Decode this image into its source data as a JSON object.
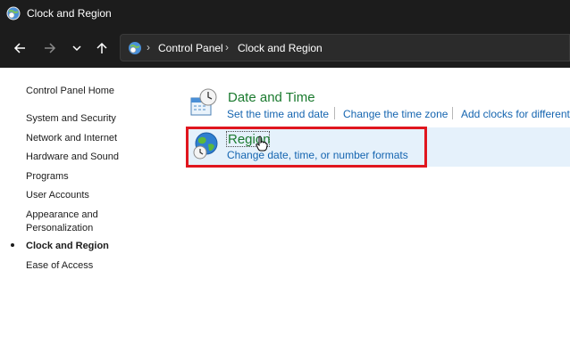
{
  "window": {
    "title": "Clock and Region"
  },
  "breadcrumb": [
    "Control Panel",
    "Clock and Region"
  ],
  "sidebar": {
    "home": "Control Panel Home",
    "items": [
      {
        "label": "System and Security",
        "active": false
      },
      {
        "label": "Network and Internet",
        "active": false
      },
      {
        "label": "Hardware and Sound",
        "active": false
      },
      {
        "label": "Programs",
        "active": false
      },
      {
        "label": "User Accounts",
        "active": false
      },
      {
        "label": "Appearance and Personalization",
        "line1": "Appearance and",
        "line2": "Personalization",
        "active": false
      },
      {
        "label": "Clock and Region",
        "active": true
      },
      {
        "label": "Ease of Access",
        "active": false
      }
    ]
  },
  "categories": [
    {
      "title": "Date and Time",
      "icon": "date-time-icon",
      "tasks": [
        "Set the time and date",
        "Change the time zone",
        "Add clocks for different"
      ]
    },
    {
      "title": "Region",
      "icon": "region-globe-icon",
      "tasks": [
        "Change date, time, or number formats"
      ]
    }
  ],
  "colors": {
    "titlebar": "#1c1c1c",
    "category_title": "#1a7a2e",
    "link": "#1565b0",
    "highlight": "#e5f1fb",
    "annotation_box": "#e0161e"
  }
}
